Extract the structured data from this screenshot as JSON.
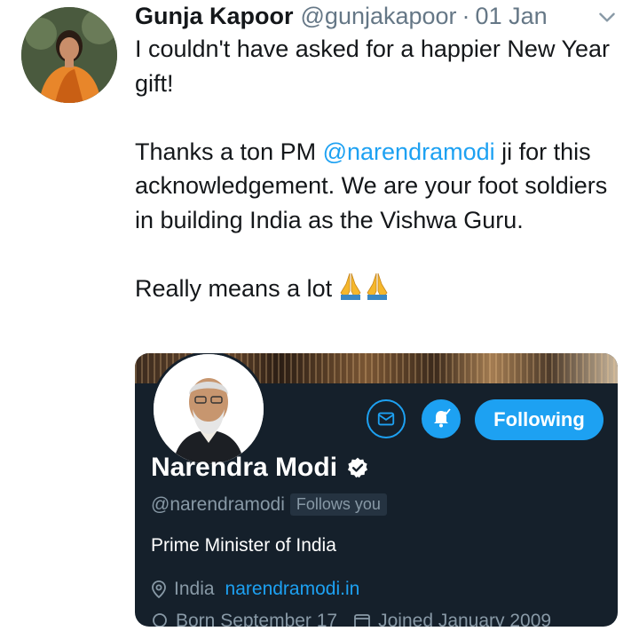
{
  "tweet": {
    "author_name": "Gunja Kapoor",
    "author_handle": "@gunjakapoor",
    "separator": "·",
    "time": "01 Jan",
    "line1": "I couldn't have asked for a happier New Year gift!",
    "line2_pre": "Thanks a ton PM ",
    "line2_mention": "@narendramodi",
    "line2_post": " ji for this acknowledgement. We are your foot soldiers in building India as the Vishwa Guru.",
    "line3": "Really means a lot",
    "emoji": "folded-hands-icon x2"
  },
  "profile_card": {
    "following_label": "Following",
    "name": "Narendra Modi",
    "handle": "@narendramodi",
    "follows_you": "Follows you",
    "bio": "Prime Minister of India",
    "location": "India",
    "url": "narendramodi.in",
    "born": "Born September 17",
    "joined": "Joined January 2009"
  },
  "colors": {
    "accent": "#1da1f2",
    "card_bg": "#15202b",
    "muted_text": "#8899a6",
    "handle_text": "#657786"
  }
}
